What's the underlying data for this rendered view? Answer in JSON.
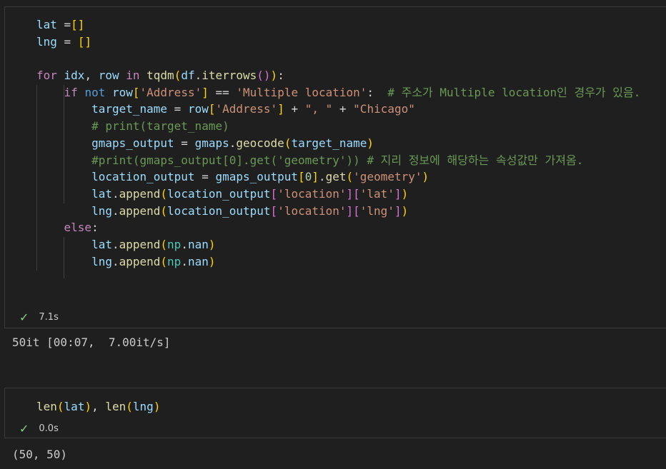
{
  "cell1": {
    "lines": [
      [
        [
          "var",
          "lat "
        ],
        [
          "op",
          "="
        ],
        [
          "b1",
          "[]"
        ]
      ],
      [
        [
          "var",
          "lng"
        ],
        [
          "op",
          " = "
        ],
        [
          "b1",
          "[]"
        ]
      ],
      [],
      [
        [
          "kw",
          "for "
        ],
        [
          "var",
          "idx"
        ],
        [
          "op",
          ", "
        ],
        [
          "var",
          "row"
        ],
        [
          "kw",
          " in "
        ],
        [
          "fn",
          "tqdm"
        ],
        [
          "b1",
          "("
        ],
        [
          "var",
          "df"
        ],
        [
          "op",
          "."
        ],
        [
          "fn",
          "iterrows"
        ],
        [
          "b2",
          "()"
        ],
        [
          "b1",
          ")"
        ],
        [
          "op",
          ":"
        ]
      ],
      [
        [
          "op",
          "    "
        ],
        [
          "kw",
          "if "
        ],
        [
          "kw2",
          "not "
        ],
        [
          "var",
          "row"
        ],
        [
          "b1",
          "["
        ],
        [
          "str",
          "'Address'"
        ],
        [
          "b1",
          "]"
        ],
        [
          "op",
          " == "
        ],
        [
          "str",
          "'Multiple location'"
        ],
        [
          "op",
          ":  "
        ],
        [
          "cm",
          "# 주소가 Multiple location인 경우가 있음."
        ]
      ],
      [
        [
          "op",
          "        "
        ],
        [
          "var",
          "target_name"
        ],
        [
          "op",
          " = "
        ],
        [
          "var",
          "row"
        ],
        [
          "b1",
          "["
        ],
        [
          "str",
          "'Address'"
        ],
        [
          "b1",
          "]"
        ],
        [
          "op",
          " + "
        ],
        [
          "str",
          "\", \""
        ],
        [
          "op",
          " + "
        ],
        [
          "str",
          "\"Chicago\""
        ]
      ],
      [
        [
          "op",
          "        "
        ],
        [
          "cm",
          "# print(target_name)"
        ]
      ],
      [
        [
          "op",
          "        "
        ],
        [
          "var",
          "gmaps_output"
        ],
        [
          "op",
          " = "
        ],
        [
          "var",
          "gmaps"
        ],
        [
          "op",
          "."
        ],
        [
          "fn",
          "geocode"
        ],
        [
          "b1",
          "("
        ],
        [
          "var",
          "target_name"
        ],
        [
          "b1",
          ")"
        ]
      ],
      [
        [
          "op",
          "        "
        ],
        [
          "cm",
          "#print(gmaps_output[0].get('geometry')) # 지리 정보에 해당하는 속성값만 가져옴."
        ]
      ],
      [
        [
          "op",
          "        "
        ],
        [
          "var",
          "location_output"
        ],
        [
          "op",
          " = "
        ],
        [
          "var",
          "gmaps_output"
        ],
        [
          "b1",
          "["
        ],
        [
          "num",
          "0"
        ],
        [
          "b1",
          "]"
        ],
        [
          "op",
          "."
        ],
        [
          "fn",
          "get"
        ],
        [
          "b1",
          "("
        ],
        [
          "str",
          "'geometry'"
        ],
        [
          "b1",
          ")"
        ]
      ],
      [
        [
          "op",
          "        "
        ],
        [
          "var",
          "lat"
        ],
        [
          "op",
          "."
        ],
        [
          "fn",
          "append"
        ],
        [
          "b1",
          "("
        ],
        [
          "var",
          "location_output"
        ],
        [
          "b2",
          "["
        ],
        [
          "str",
          "'location'"
        ],
        [
          "b2",
          "]["
        ],
        [
          "str",
          "'lat'"
        ],
        [
          "b2",
          "]"
        ],
        [
          "b1",
          ")"
        ]
      ],
      [
        [
          "op",
          "        "
        ],
        [
          "var",
          "lng"
        ],
        [
          "op",
          "."
        ],
        [
          "fn",
          "append"
        ],
        [
          "b1",
          "("
        ],
        [
          "var",
          "location_output"
        ],
        [
          "b2",
          "["
        ],
        [
          "str",
          "'location'"
        ],
        [
          "b2",
          "]["
        ],
        [
          "str",
          "'lng'"
        ],
        [
          "b2",
          "]"
        ],
        [
          "b1",
          ")"
        ]
      ],
      [
        [
          "op",
          "    "
        ],
        [
          "kw",
          "else"
        ],
        [
          "op",
          ":"
        ]
      ],
      [
        [
          "op",
          "        "
        ],
        [
          "var",
          "lat"
        ],
        [
          "op",
          "."
        ],
        [
          "fn",
          "append"
        ],
        [
          "b1",
          "("
        ],
        [
          "ty",
          "np"
        ],
        [
          "op",
          "."
        ],
        [
          "var",
          "nan"
        ],
        [
          "b1",
          ")"
        ]
      ],
      [
        [
          "op",
          "        "
        ],
        [
          "var",
          "lng"
        ],
        [
          "op",
          "."
        ],
        [
          "fn",
          "append"
        ],
        [
          "b1",
          "("
        ],
        [
          "ty",
          "np"
        ],
        [
          "op",
          "."
        ],
        [
          "var",
          "nan"
        ],
        [
          "b1",
          ")"
        ]
      ]
    ],
    "status_time": "7.1s",
    "output": "50it [00:07,  7.00it/s]"
  },
  "cell2": {
    "lines": [
      [
        [
          "fn",
          "len"
        ],
        [
          "b1",
          "("
        ],
        [
          "var",
          "lat"
        ],
        [
          "b1",
          ")"
        ],
        [
          "op",
          ", "
        ],
        [
          "fn",
          "len"
        ],
        [
          "b1",
          "("
        ],
        [
          "var",
          "lng"
        ],
        [
          "b1",
          ")"
        ]
      ]
    ],
    "status_time": "0.0s",
    "output": "(50, 50)"
  },
  "icons": {
    "status": "check-icon"
  }
}
